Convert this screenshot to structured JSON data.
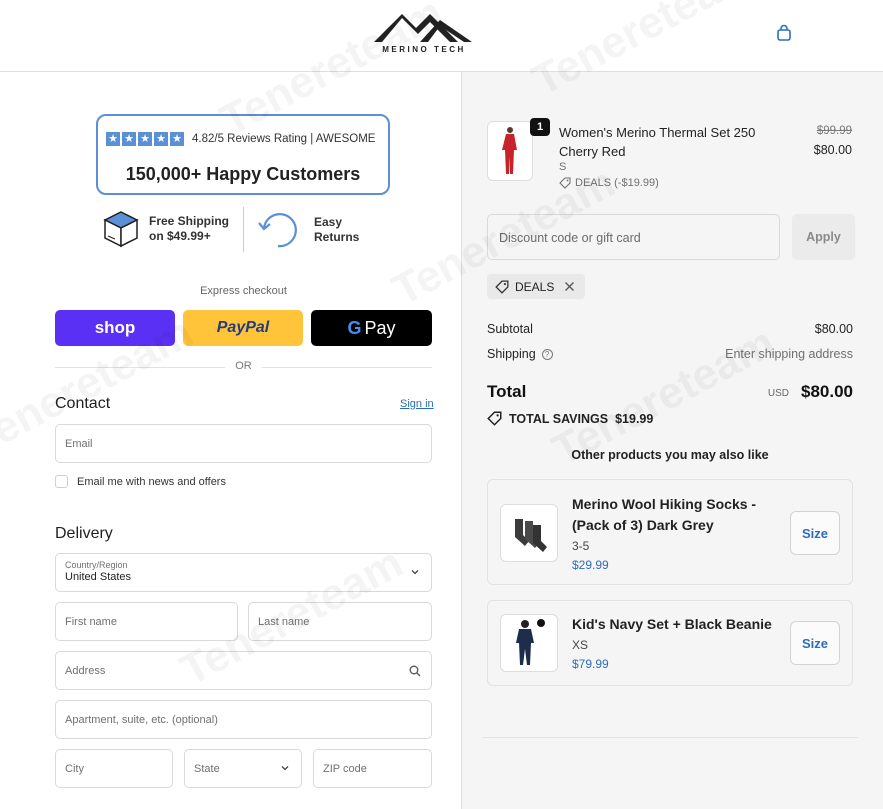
{
  "header": {
    "brand": "MERINO TECH",
    "cart_icon": "shopping-bag-icon"
  },
  "trust": {
    "rating_text": "4.82/5 Reviews Rating | AWESOME",
    "headline": "150,000+ Happy Customers",
    "shipping_line1": "Free Shipping",
    "shipping_line2": "on $49.99+",
    "returns_line1": "Easy",
    "returns_line2": "Returns"
  },
  "express": {
    "label": "Express checkout",
    "shop_label": "shop",
    "paypal_label": "PayPal",
    "gpay_g": "G",
    "gpay_label": "Pay",
    "or_label": "OR"
  },
  "contact": {
    "title": "Contact",
    "signin_label": "Sign in",
    "email_placeholder": "Email",
    "newsletter_label": "Email me with news and offers"
  },
  "delivery": {
    "title": "Delivery",
    "country_label": "Country/Region",
    "country_value": "United States",
    "first_name_placeholder": "First name",
    "last_name_placeholder": "Last name",
    "address_placeholder": "Address",
    "apartment_placeholder": "Apartment, suite, etc. (optional)",
    "city_placeholder": "City",
    "state_placeholder": "State",
    "zip_placeholder": "ZIP code"
  },
  "watermark": "Tenereteam",
  "order": {
    "item": {
      "quantity": "1",
      "name": "Women's Merino Thermal Set 250 Cherry Red",
      "variant": "S",
      "deal": "DEALS (-$19.99)",
      "price_original": "$99.99",
      "price_final": "$80.00"
    },
    "discount_placeholder": "Discount code or gift card",
    "apply_label": "Apply",
    "applied_code": "DEALS",
    "subtotal_label": "Subtotal",
    "subtotal_value": "$80.00",
    "shipping_label": "Shipping",
    "shipping_value": "Enter shipping address",
    "total_label": "Total",
    "total_currency": "USD",
    "total_value": "$80.00",
    "savings_label": "TOTAL SAVINGS",
    "savings_value": "$19.99"
  },
  "recommendations": {
    "title": "Other products you may also like",
    "items": [
      {
        "name": "Merino Wool Hiking Socks - (Pack of 3) Dark Grey",
        "variant": "3-5",
        "price": "$29.99",
        "button": "Size"
      },
      {
        "name": "Kid's Navy Set + Black Beanie",
        "variant": "XS",
        "price": "$79.99",
        "button": "Size"
      }
    ]
  },
  "colors": {
    "accent_blue": "#2a6ebb",
    "rating_blue": "#5b8fd6",
    "shop_purple": "#5a31f4",
    "paypal_yellow": "#ffc439"
  }
}
